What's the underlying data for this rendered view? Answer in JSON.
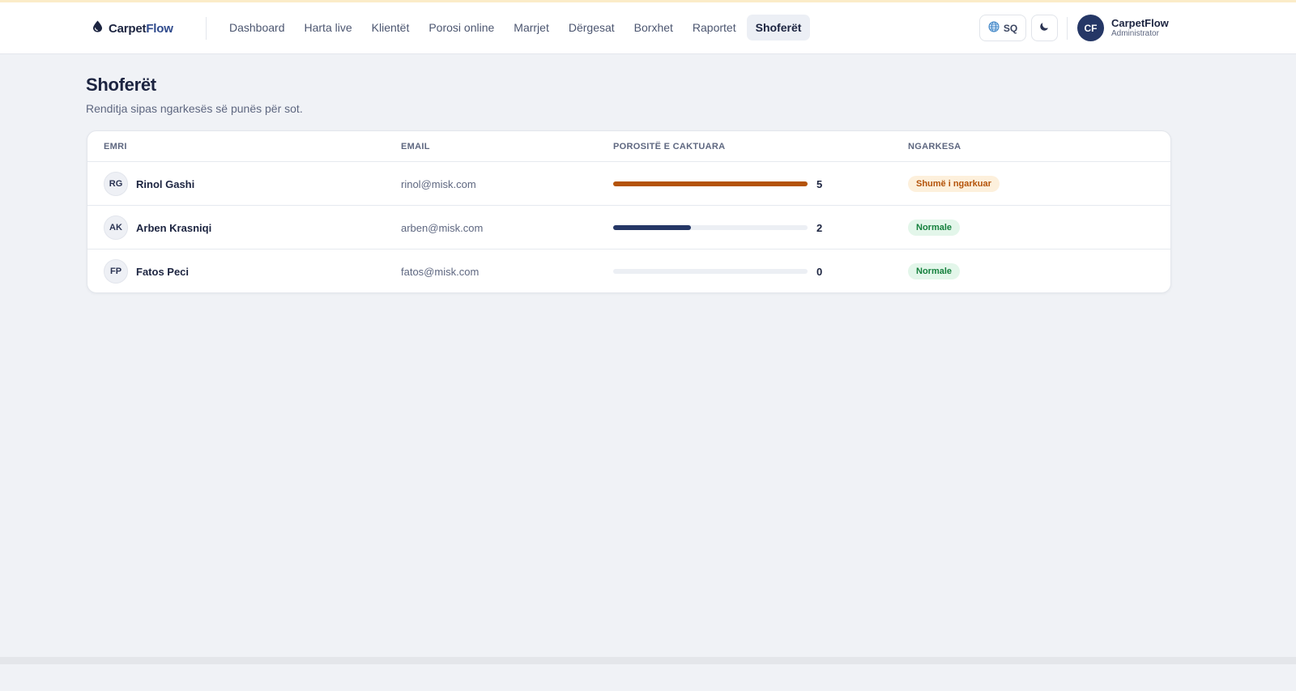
{
  "brand": {
    "name_main": "Carpet",
    "name_accent": "Flow",
    "icon": "drop-icon"
  },
  "nav": [
    {
      "label": "Dashboard",
      "active": false
    },
    {
      "label": "Harta live",
      "active": false
    },
    {
      "label": "Klientët",
      "active": false
    },
    {
      "label": "Porosi online",
      "active": false
    },
    {
      "label": "Marrjet",
      "active": false
    },
    {
      "label": "Dërgesat",
      "active": false
    },
    {
      "label": "Borxhet",
      "active": false
    },
    {
      "label": "Raportet",
      "active": false
    },
    {
      "label": "Shoferët",
      "active": true
    }
  ],
  "header": {
    "lang_label": "SQ",
    "lang_icon": "globe-icon",
    "theme_icon": "moon-icon"
  },
  "user": {
    "initials": "CF",
    "name": "CarpetFlow",
    "role": "Administrator"
  },
  "page": {
    "title": "Shoferët",
    "subtitle": "Renditja sipas ngarkesës së punës për sot."
  },
  "table": {
    "columns": {
      "name": "EMRI",
      "email": "EMAIL",
      "orders": "POROSITË E CAKTUARA",
      "load": "NGARKESA"
    },
    "max_orders": 5,
    "rows": [
      {
        "initials": "RG",
        "name": "Rinol Gashi",
        "email": "rinol@misk.com",
        "orders": 5,
        "load": "Shumë i ngarkuar",
        "load_level": "high",
        "bar_color": "#b45309"
      },
      {
        "initials": "AK",
        "name": "Arben Krasniqi",
        "email": "arben@misk.com",
        "orders": 2,
        "load": "Normale",
        "load_level": "normal",
        "bar_color": "#253766"
      },
      {
        "initials": "FP",
        "name": "Fatos Peci",
        "email": "fatos@misk.com",
        "orders": 0,
        "load": "Normale",
        "load_level": "normal",
        "bar_color": "#253766"
      }
    ]
  },
  "colors": {
    "accent": "#253766",
    "high": "#b45309",
    "normal": "#15803d"
  }
}
